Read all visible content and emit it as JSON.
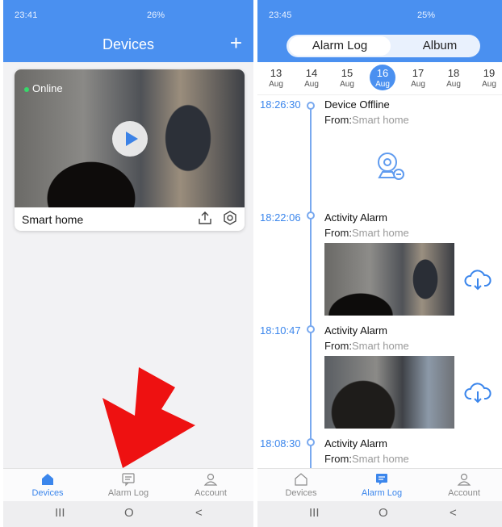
{
  "left": {
    "status": {
      "time": "23:41",
      "right": "26%"
    },
    "header": {
      "title": "Devices",
      "add_label": "+"
    },
    "device": {
      "status": "Online",
      "name": "Smart home"
    },
    "tabs": [
      {
        "label": "Devices",
        "icon": "home-icon"
      },
      {
        "label": "Alarm Log",
        "icon": "alarm-log-icon"
      },
      {
        "label": "Account",
        "icon": "person-icon"
      }
    ],
    "nav": {
      "recent": "III",
      "home": "O",
      "back": "<"
    }
  },
  "right": {
    "status": {
      "time": "23:45",
      "right": "25%"
    },
    "segments": {
      "active": "Alarm Log",
      "other": "Album"
    },
    "dates": [
      {
        "day": "13",
        "month": "Aug"
      },
      {
        "day": "14",
        "month": "Aug"
      },
      {
        "day": "15",
        "month": "Aug"
      },
      {
        "day": "16",
        "month": "Aug"
      },
      {
        "day": "17",
        "month": "Aug"
      },
      {
        "day": "18",
        "month": "Aug"
      },
      {
        "day": "19",
        "month": "Aug"
      }
    ],
    "events": [
      {
        "time": "18:26:30",
        "title": "Device Offline",
        "from_label": "From:",
        "from": "Smart home"
      },
      {
        "time": "18:22:06",
        "title": "Activity Alarm",
        "from_label": "From:",
        "from": "Smart home"
      },
      {
        "time": "18:10:47",
        "title": "Activity Alarm",
        "from_label": "From:",
        "from": "Smart home"
      },
      {
        "time": "18:08:30",
        "title": "Activity Alarm",
        "from_label": "From:",
        "from": "Smart home"
      }
    ],
    "tabs": [
      {
        "label": "Devices",
        "icon": "home-icon"
      },
      {
        "label": "Alarm Log",
        "icon": "alarm-log-icon"
      },
      {
        "label": "Account",
        "icon": "person-icon"
      }
    ],
    "nav": {
      "recent": "III",
      "home": "O",
      "back": "<"
    }
  },
  "colors": {
    "accent": "#4a90f0",
    "active_tab": "#3b86ec",
    "online": "#37d96a",
    "arrow": "#ee1111"
  }
}
